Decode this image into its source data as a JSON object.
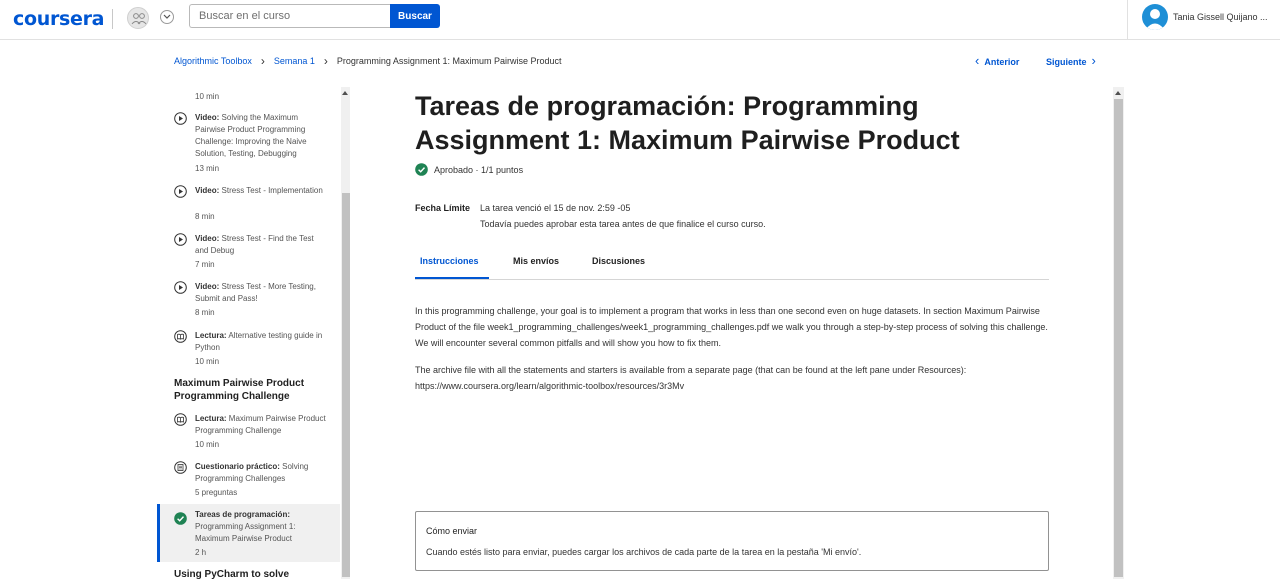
{
  "header": {
    "logo": "coursera",
    "search_placeholder": "Buscar en el curso",
    "search_button": "Buscar",
    "user_name": "Tania Gissell Quijano ..."
  },
  "breadcrumb": {
    "items": [
      "Algorithmic Toolbox",
      "Semana 1",
      "Programming Assignment 1: Maximum Pairwise Product"
    ],
    "prev": "Anterior",
    "next": "Siguiente"
  },
  "sidebar": {
    "items": [
      {
        "kind": "",
        "title": "",
        "duration": "10 min",
        "icon": ""
      },
      {
        "kind": "Video:",
        "title": "Solving the Maximum Pairwise Product Programming Challenge: Improving the Naive Solution, Testing, Debugging",
        "duration": "13 min",
        "icon": "play-circle-icon"
      },
      {
        "kind": "Video:",
        "title": "Stress Test - Implementation",
        "duration": "8 min",
        "icon": "play-circle-icon"
      },
      {
        "kind": "Video:",
        "title": "Stress Test - Find the Test and Debug",
        "duration": "7 min",
        "icon": "play-circle-icon"
      },
      {
        "kind": "Video:",
        "title": "Stress Test - More Testing, Submit and Pass!",
        "duration": "8 min",
        "icon": "play-circle-icon"
      },
      {
        "kind": "Lectura:",
        "title": "Alternative testing guide in Python",
        "duration": "10 min",
        "icon": "reading-icon"
      },
      {
        "kind": "Lectura:",
        "title": "Maximum Pairwise Product Programming Challenge",
        "duration": "10 min",
        "icon": "reading-icon"
      },
      {
        "kind": "Cuestionario práctico:",
        "title": "Solving Programming Challenges",
        "duration": "5 preguntas",
        "icon": "quiz-icon"
      },
      {
        "kind": "Tareas de programación:",
        "title": "Programming Assignment 1: Maximum Pairwise Product",
        "duration": "2 h",
        "icon": "check-circle-icon"
      }
    ],
    "sections": [
      "Maximum Pairwise Product Programming Challenge",
      "Using PyCharm to solve"
    ]
  },
  "main": {
    "title": "Tareas de programación: Programming Assignment 1: Maximum Pairwise Product",
    "status": "Aprobado · 1/1 puntos",
    "deadline_label": "Fecha Límite",
    "deadline_line1": "La tarea venció el 15 de nov. 2:59 -05",
    "deadline_line2": "Todavía puedes aprobar esta tarea antes de que finalice el curso curso.",
    "tabs": [
      "Instrucciones",
      "Mis envíos",
      "Discusiones"
    ],
    "paragraphs": [
      "In this programming challenge, your goal is to implement a program that works in less than one second even on huge datasets. In section Maximum Pairwise Product of the file week1_programming_challenges/week1_programming_challenges.pdf we walk you through a step-by-step process of solving this challenge. We will encounter several common pitfalls and will show you how to fix them.",
      "The archive file with all the statements and starters is available from a separate page (that can be found at the left pane under Resources): https://www.coursera.org/learn/algorithmic-toolbox/resources/3r3Mv"
    ],
    "callout_title": "Cómo enviar",
    "callout_body": "Cuando estés listo para enviar, puedes cargar los archivos de cada parte de la tarea en la pestaña 'Mi envío'."
  },
  "colors": {
    "brand": "#0056d2",
    "success": "#1f8354"
  }
}
